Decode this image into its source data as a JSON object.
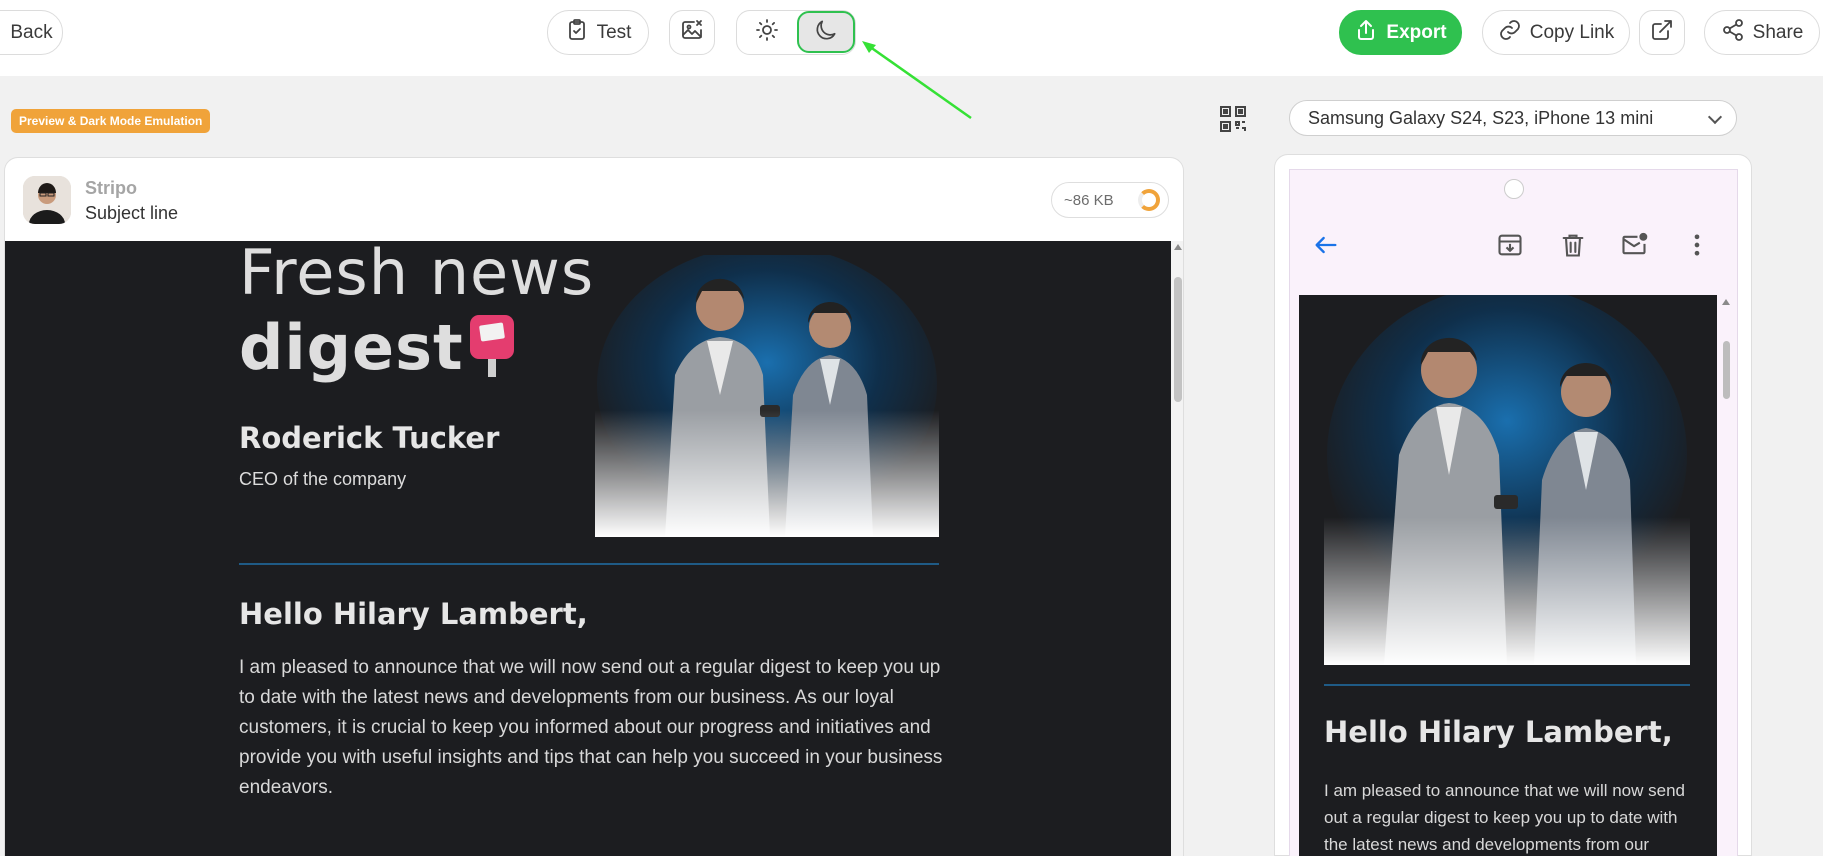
{
  "toolbar": {
    "back_label": "Back",
    "test_label": "Test",
    "export_label": "Export",
    "copy_link_label": "Copy Link",
    "share_label": "Share",
    "active_mode": "dark",
    "accent_color": "#2fc14f"
  },
  "preview": {
    "badge": "Preview & Dark Mode Emulation",
    "sender_name": "Stripo",
    "subject": "Subject line",
    "size": "~86 KB"
  },
  "email": {
    "headline_line1": "Fresh news",
    "headline_line2": "digest",
    "ceo_name": "Roderick Tucker",
    "ceo_role": "CEO of the company",
    "greeting": "Hello Hilary Lambert,",
    "body": "I am pleased to announce that we will now send out a regular digest to keep you up to date with the latest news and developments from our business. As our loyal customers, it is crucial to keep you informed about our progress and initiatives and provide you with useful insights and tips that can help you succeed in your business endeavors.",
    "mobile_body": "I am pleased to announce that we will now send out a regular digest to keep you up to date with the latest news and developments from our"
  },
  "mobile": {
    "device": "Samsung Galaxy S24, S23, iPhone 13 mini"
  },
  "icons": [
    "clipboard-check-icon",
    "image-off-icon",
    "sun-icon",
    "moon-icon",
    "upload-icon",
    "link-icon",
    "external-link-icon",
    "share-icon",
    "qr-code-icon",
    "back-arrow-icon",
    "archive-icon",
    "trash-icon",
    "mark-unread-icon",
    "more-vert-icon",
    "chevron-down-icon"
  ]
}
